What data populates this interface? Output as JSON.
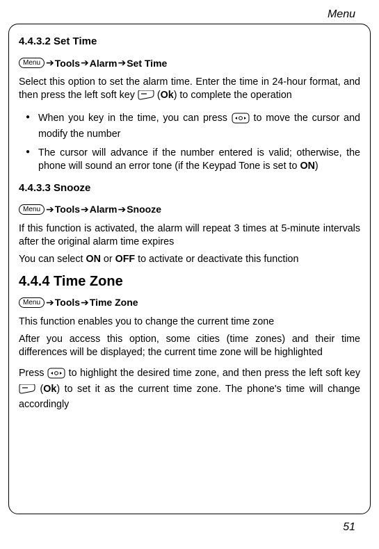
{
  "header": {
    "running_title": "Menu"
  },
  "footer": {
    "page_number": "51"
  },
  "keys": {
    "menu_label": "Menu"
  },
  "sec1": {
    "heading": "4.4.3.2 Set Time",
    "nav": {
      "s1": "Tools",
      "s2": "Alarm",
      "s3": "Set Time"
    },
    "p1a": "Select this option to set the alarm time. Enter the time in 24-hour format, and then press the left soft key ",
    "p1b": " (",
    "p1c": "Ok",
    "p1d": ") to complete the operation",
    "li1a": "When you key in the time, you can press ",
    "li1b": " to move the cursor and modify the number",
    "li2a": "The cursor will advance if the number entered is valid; otherwise, the phone will sound an error tone (if the Keypad Tone is set to ",
    "li2b": "ON",
    "li2c": ")"
  },
  "sec2": {
    "heading": "4.4.3.3 Snooze",
    "nav": {
      "s1": "Tools",
      "s2": "Alarm",
      "s3": "Snooze"
    },
    "p1": "If this function is activated, the alarm will repeat 3 times at 5-minute intervals after the original alarm time expires",
    "p2a": "You can select ",
    "p2b": "ON",
    "p2c": " or ",
    "p2d": "OFF",
    "p2e": " to activate or deactivate this function"
  },
  "sec3": {
    "heading": "4.4.4 Time Zone",
    "nav": {
      "s1": "Tools",
      "s2": "Time Zone"
    },
    "p1": "This function enables you to change the current time zone",
    "p2": "After you access this option, some cities (time zones) and their time differences will be displayed; the current time zone will be highlighted",
    "p3a": "Press ",
    "p3b": " to highlight the desired time zone, and then press the left soft key ",
    "p3c": " (",
    "p3d": "Ok",
    "p3e": ") to set it as the current time zone. The phone's time will change accordingly"
  }
}
